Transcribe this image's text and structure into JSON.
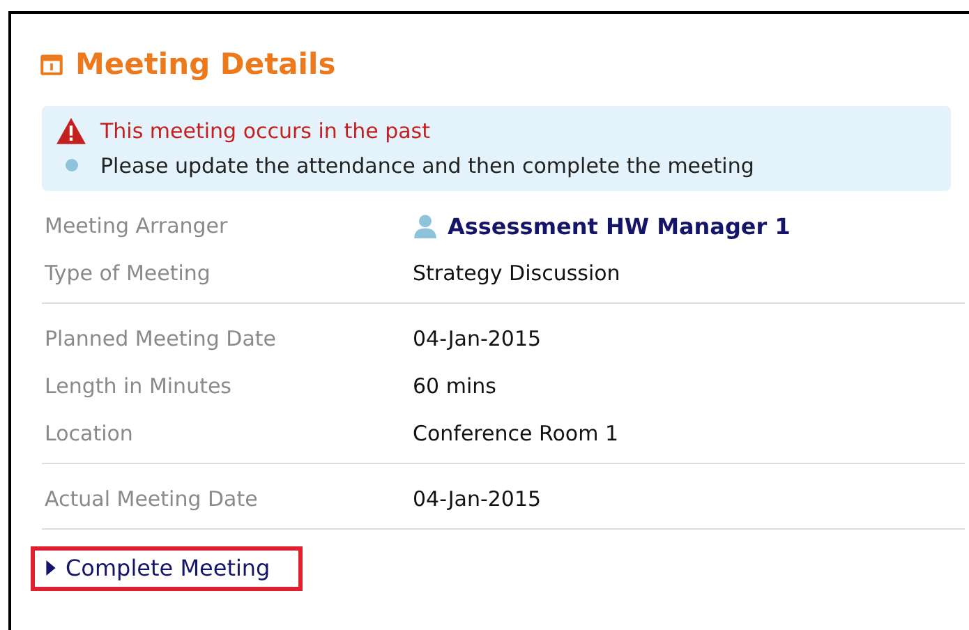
{
  "panel": {
    "title": "Meeting Details"
  },
  "alerts": [
    {
      "kind": "warning",
      "text": "This meeting occurs in the past"
    },
    {
      "kind": "info",
      "text": "Please update the attendance and then complete the meeting"
    }
  ],
  "groups": [
    {
      "rows": [
        {
          "label": "Meeting Arranger",
          "value": "Assessment HW Manager 1",
          "kind": "person"
        },
        {
          "label": "Type of Meeting",
          "value": "Strategy Discussion",
          "kind": "text"
        }
      ]
    },
    {
      "rows": [
        {
          "label": "Planned Meeting Date",
          "value": "04-Jan-2015",
          "kind": "text"
        },
        {
          "label": "Length in Minutes",
          "value": "60 mins",
          "kind": "text"
        },
        {
          "label": "Location",
          "value": "Conference Room 1",
          "kind": "text"
        }
      ]
    },
    {
      "rows": [
        {
          "label": "Actual Meeting Date",
          "value": "04-Jan-2015",
          "kind": "text"
        }
      ]
    }
  ],
  "action": {
    "label": "Complete Meeting",
    "highlighted": true
  }
}
